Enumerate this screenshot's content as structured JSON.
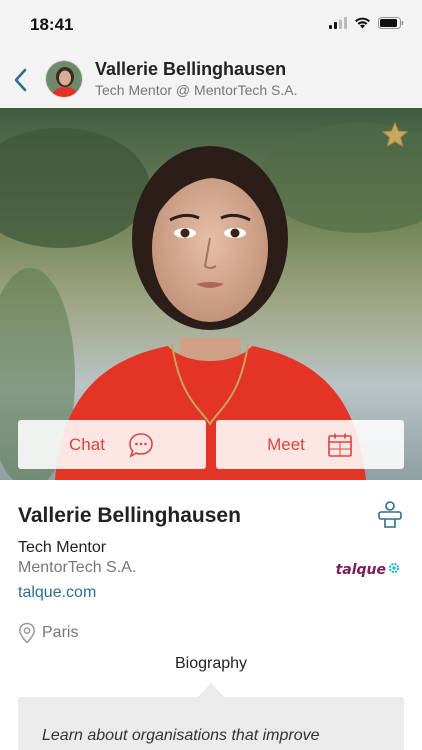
{
  "status_bar": {
    "time": "18:41"
  },
  "header": {
    "name": "Vallerie Bellinghausen",
    "subtitle": "Tech Mentor @ MentorTech S.A."
  },
  "actions": {
    "chat_label": "Chat",
    "meet_label": "Meet"
  },
  "profile": {
    "name": "Vallerie Bellinghausen",
    "role": "Tech Mentor",
    "company": "MentorTech S.A.",
    "website": "talque.com",
    "location": "Paris",
    "brand": "talque"
  },
  "tabs": {
    "biography": "Biography"
  },
  "biography": {
    "text": "Learn about organisations that improve"
  },
  "colors": {
    "accent": "#d9453f",
    "link": "#2e6e8e",
    "star": "#c7a660"
  },
  "icons": [
    "back-icon",
    "star-icon",
    "chat-bubble-icon",
    "calendar-icon",
    "contact-icon",
    "location-pin-icon"
  ]
}
